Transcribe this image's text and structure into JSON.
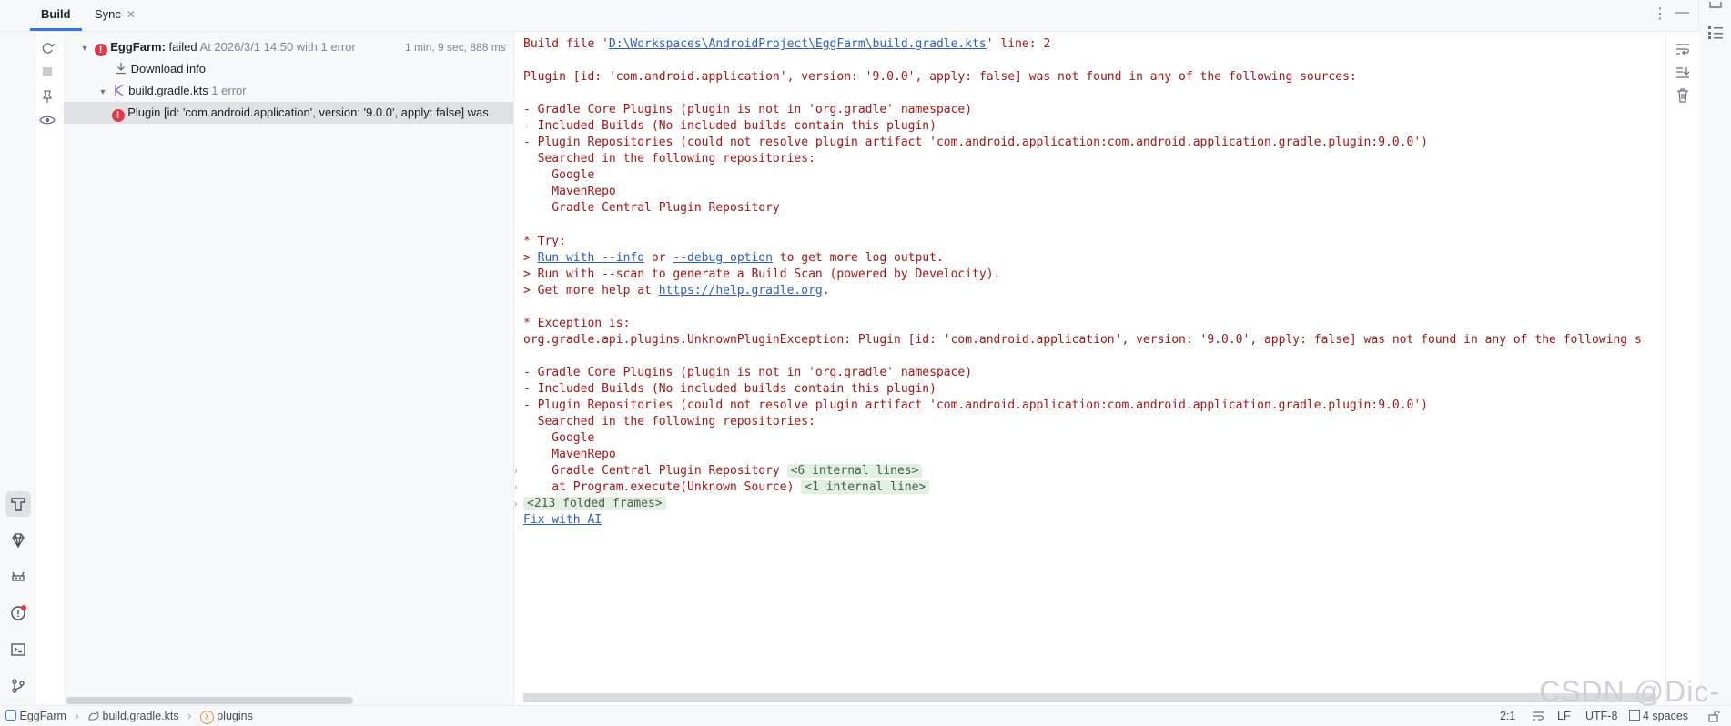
{
  "tabs": [
    {
      "label": "Build"
    },
    {
      "label": "Sync"
    }
  ],
  "tree": {
    "root": {
      "name": "EggFarm:",
      "status": "failed",
      "detail": "At 2026/3/1 14:50 with 1 error",
      "duration": "1 min, 9 sec, 888 ms"
    },
    "download": "Download info",
    "file": {
      "name": "build.gradle.kts",
      "count": "1 error"
    },
    "error": "Plugin [id: 'com.android.application', version: '9.0.0', apply: false] was"
  },
  "console": {
    "line1_a": "Build file '",
    "line1_link": "D:\\Workspaces\\AndroidProject\\EggFarm\\build.gradle.kts",
    "line1_b": "' line: 2",
    "plugin_msg": "Plugin [id: 'com.android.application', version: '9.0.0', apply: false] was not found in any of the following sources:",
    "core": "- Gradle Core Plugins (plugin is not in 'org.gradle' namespace)",
    "included": "- Included Builds (No included builds contain this plugin)",
    "repos": "- Plugin Repositories (could not resolve plugin artifact 'com.android.application:com.android.application.gradle.plugin:9.0.0')",
    "searched": "  Searched in the following repositories:",
    "google": "    Google",
    "maven": "    MavenRepo",
    "central": "    Gradle Central Plugin Repository",
    "try": "* Try:",
    "run_prefix": "> ",
    "run_info": "Run with --info",
    "or": " or ",
    "debug": "--debug option",
    "run_suffix": " to get more log output.",
    "scan": "> Run with --scan to generate a Build Scan (powered by Develocity).",
    "help_prefix": "> Get more help at ",
    "help_link": "https://help.gradle.org",
    "help_suffix": ".",
    "exception": "* Exception is:",
    "exception_line": "org.gradle.api.plugins.UnknownPluginException: Plugin [id: 'com.android.application', version: '9.0.0', apply: false] was not found in any of the following s",
    "internal6": "<6 internal lines>",
    "at_program": "    at Program.execute(Unknown Source)",
    "internal1": "<1 internal line>",
    "folded": "<213 folded frames>",
    "fix_ai": "Fix with AI"
  },
  "statusbar": {
    "crumb1": "EggFarm",
    "crumb2": "build.gradle.kts",
    "crumb3": "plugins",
    "position": "2:1",
    "line_sep": "LF",
    "encoding": "UTF-8",
    "indent": "4 spaces"
  },
  "watermark": "CSDN @Dic-"
}
